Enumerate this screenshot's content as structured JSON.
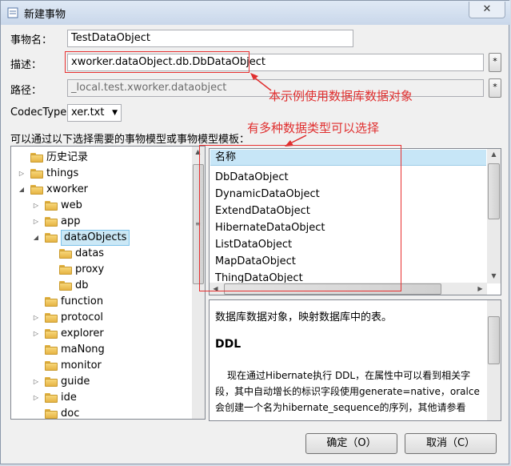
{
  "window": {
    "title": "新建事物",
    "close_glyph": "✕"
  },
  "form": {
    "name_label": "事物名：",
    "name_value": "TestDataObject",
    "desc_label": "描述：",
    "desc_value": "xworker.dataObject.db.DbDataObject",
    "desc_button": "*",
    "path_label": "路径：",
    "path_value": "_local.test.xworker.dataobject",
    "path_button": "*",
    "codec_label": "CodecType",
    "codec_value": "xer.txt",
    "section_label": "可以通过以下选择需要的事物模型或事物模型模板："
  },
  "annotations": {
    "note1": "本示例使用数据库数据对象",
    "note2": "有多种数据类型可以选择",
    "color": "#e03030"
  },
  "tree": {
    "items": [
      {
        "label": "历史记录",
        "level": 1,
        "expander": ""
      },
      {
        "label": "things",
        "level": 1,
        "expander": "▷"
      },
      {
        "label": "xworker",
        "level": 1,
        "expander": "◢"
      },
      {
        "label": "web",
        "level": 2,
        "expander": "▷"
      },
      {
        "label": "app",
        "level": 2,
        "expander": "▷"
      },
      {
        "label": "dataObjects",
        "level": 2,
        "expander": "◢",
        "selected": true
      },
      {
        "label": "datas",
        "level": 3,
        "expander": ""
      },
      {
        "label": "proxy",
        "level": 3,
        "expander": ""
      },
      {
        "label": "db",
        "level": 3,
        "expander": ""
      },
      {
        "label": "function",
        "level": 2,
        "expander": ""
      },
      {
        "label": "protocol",
        "level": 2,
        "expander": "▷"
      },
      {
        "label": "explorer",
        "level": 2,
        "expander": "▷"
      },
      {
        "label": "maNong",
        "level": 2,
        "expander": ""
      },
      {
        "label": "monitor",
        "level": 2,
        "expander": ""
      },
      {
        "label": "guide",
        "level": 2,
        "expander": "▷"
      },
      {
        "label": "ide",
        "level": 2,
        "expander": "▷"
      },
      {
        "label": "doc",
        "level": 2,
        "expander": ""
      }
    ]
  },
  "list": {
    "header": "名称",
    "items": [
      "DbDataObject",
      "DynamicDataObject",
      "ExtendDataObject",
      "HibernateDataObject",
      "ListDataObject",
      "MapDataObject",
      "ThingDataObject"
    ]
  },
  "description": {
    "line1": "数据库数据对象，映射数据库中的表。",
    "heading": "DDL",
    "para_line1": "现在通过Hibernate执行 DDL，在属性中可以看到相关字",
    "para_line2": "段，其中自动增长的标识字段使用generate=native，oralce",
    "para_line3": "会创建一个名为hibernate_sequence的序列，其他请参看"
  },
  "buttons": {
    "ok": "确定（O）",
    "cancel": "取消（C）"
  }
}
